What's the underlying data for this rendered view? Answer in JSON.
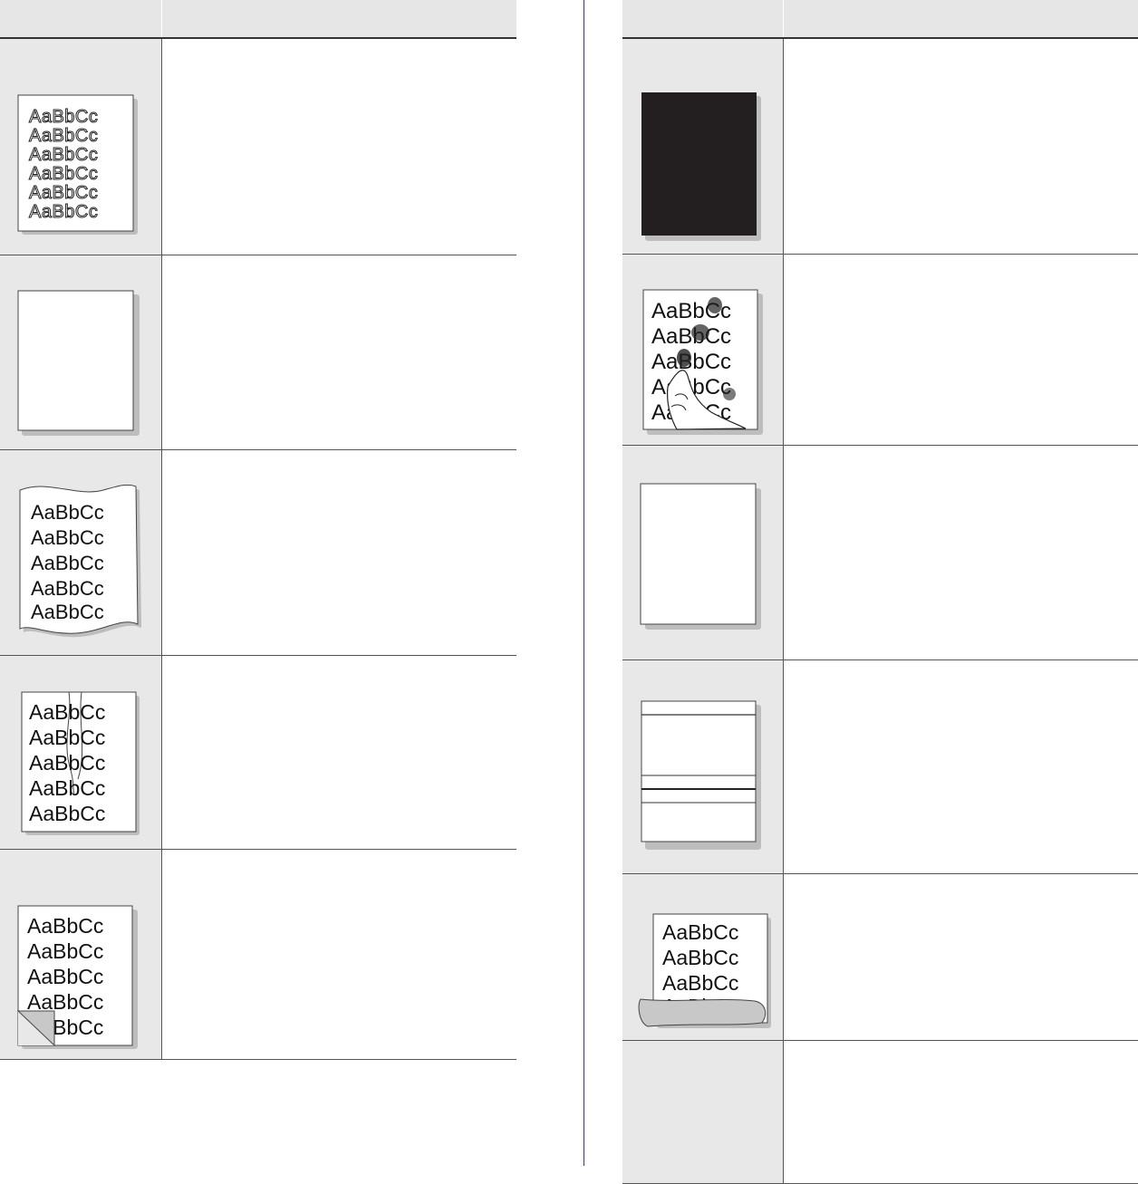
{
  "left_table": {
    "header": {
      "col1": "",
      "col2": ""
    },
    "rows": [
      {
        "illustration": "light-print-page-icon",
        "sample_text": "AaBbCc",
        "description": ""
      },
      {
        "illustration": "blank-page-icon",
        "sample_text": "",
        "description": ""
      },
      {
        "illustration": "curled-page-icon",
        "sample_text": "AaBbCc",
        "description": ""
      },
      {
        "illustration": "wrinkled-page-icon",
        "sample_text": "AaBbCc",
        "description": ""
      },
      {
        "illustration": "folded-corner-page-icon",
        "sample_text": "AaBbCc",
        "description": ""
      }
    ]
  },
  "right_table": {
    "header": {
      "col1": "",
      "col2": ""
    },
    "rows": [
      {
        "illustration": "black-page-icon",
        "sample_text": "",
        "description": ""
      },
      {
        "illustration": "loose-toner-page-icon",
        "sample_text": "AaBbCc",
        "description": ""
      },
      {
        "illustration": "blank-page-icon",
        "sample_text": "",
        "description": ""
      },
      {
        "illustration": "horizontal-stripes-page-icon",
        "sample_text": "",
        "description": ""
      },
      {
        "illustration": "paper-wrap-page-icon",
        "sample_text": "AaBbCc",
        "description": ""
      },
      {
        "illustration": "",
        "sample_text": "",
        "description": ""
      }
    ]
  },
  "colors": {
    "header_bg": "#e6e6e6",
    "cell_bg": "#e8e8e8",
    "rule": "#333333",
    "divider": "#3c3d6e",
    "shadow": "#bdbdbd",
    "toner": "#231f20"
  }
}
